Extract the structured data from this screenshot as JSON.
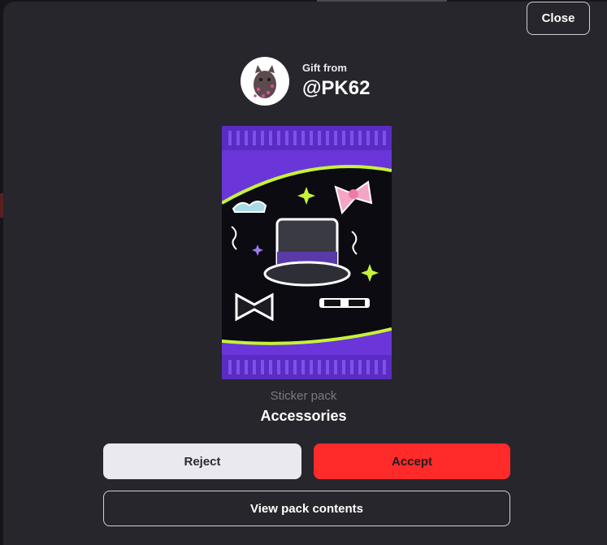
{
  "dialog": {
    "close_label": "Close"
  },
  "gift": {
    "from_label": "Gift from",
    "sender_handle": "@PK62"
  },
  "pack": {
    "type_label": "Sticker pack",
    "name": "Accessories"
  },
  "actions": {
    "reject_label": "Reject",
    "accept_label": "Accept",
    "view_label": "View pack contents"
  },
  "colors": {
    "modal_bg": "#26262c",
    "accept": "#ff2a2a",
    "reject": "#e9e9ef",
    "pack_purple": "#7b3fe4",
    "pack_accent": "#c6f23a"
  },
  "icons": {
    "avatar": "cat-avatar-icon",
    "pack_art": "sticker-pack-icon"
  }
}
